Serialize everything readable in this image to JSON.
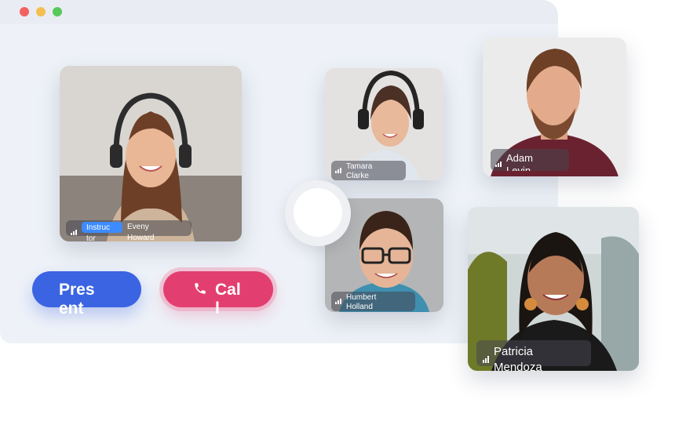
{
  "window": {
    "controls": [
      "close",
      "minimize",
      "maximize"
    ]
  },
  "participants": {
    "instructor": {
      "role": "Instruc tor",
      "name": "Eveny Howard"
    },
    "tamara": {
      "name": "Tamara Clarke"
    },
    "adam": {
      "name": "Adam Levin"
    },
    "humbert": {
      "name": "Humbert Holland"
    },
    "patricia": {
      "name": "Patricia Mendoza"
    }
  },
  "buttons": {
    "present": "Present",
    "call": "Call"
  },
  "colors": {
    "accent_blue": "#3b64e2",
    "accent_pink": "#e23f70",
    "role_badge": "#3d8bff"
  },
  "icons": [
    "signal-icon",
    "phone-icon",
    "record-button-icon"
  ]
}
